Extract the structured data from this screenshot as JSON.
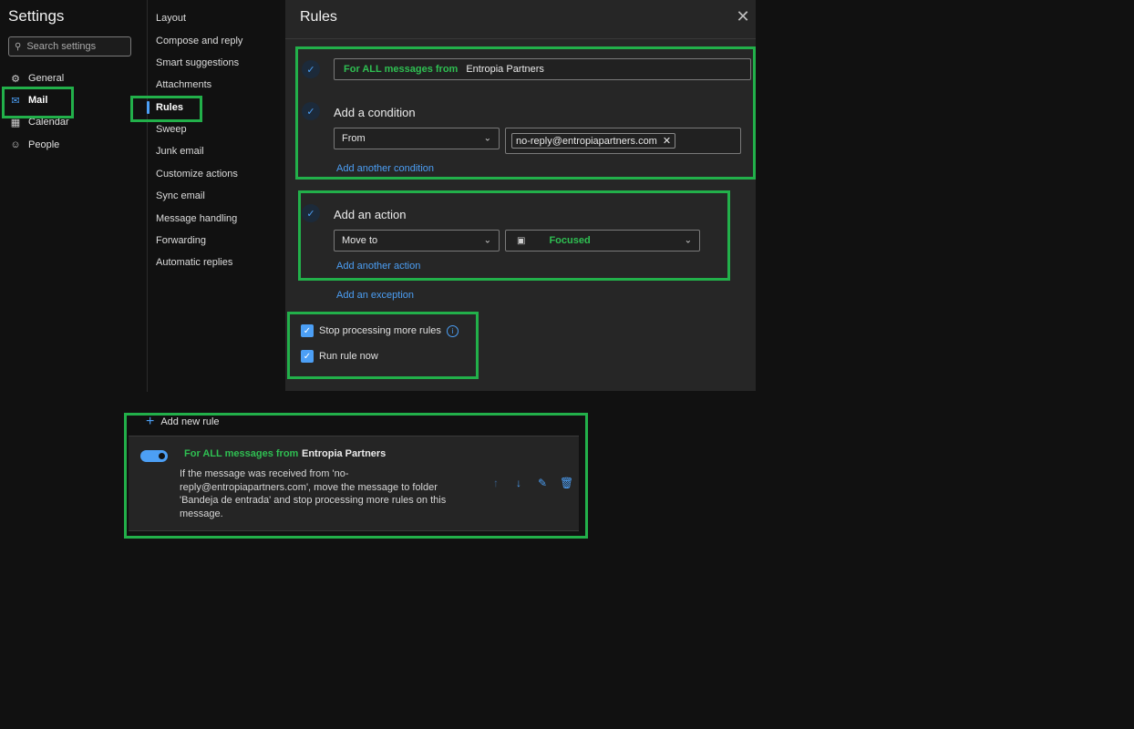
{
  "settings": {
    "title": "Settings",
    "search_placeholder": "Search settings",
    "nav": [
      {
        "label": "General",
        "icon": "gear-icon"
      },
      {
        "label": "Mail",
        "icon": "mail-icon"
      },
      {
        "label": "Calendar",
        "icon": "calendar-icon"
      },
      {
        "label": "People",
        "icon": "people-icon"
      }
    ]
  },
  "mail_nav": [
    "Layout",
    "Compose and reply",
    "Smart suggestions",
    "Attachments",
    "Rules",
    "Sweep",
    "Junk email",
    "Customize actions",
    "Sync email",
    "Message handling",
    "Forwarding",
    "Automatic replies"
  ],
  "rules_panel": {
    "title": "Rules",
    "rule_name_prefix": "For ALL messages from",
    "rule_name_value": "Entropia Partners",
    "condition_heading": "Add a condition",
    "condition_field": "From",
    "condition_value": "no-reply@entropiapartners.com",
    "add_condition_link": "Add another condition",
    "action_heading": "Add an action",
    "action_field": "Move to",
    "action_folder": "Focused",
    "add_action_link": "Add another action",
    "add_exception_link": "Add an exception",
    "stop_processing_label": "Stop processing more rules",
    "stop_processing_checked": true,
    "run_now_label": "Run rule now",
    "run_now_checked": true
  },
  "rule_list": {
    "add_new_rule": "Add new rule",
    "rule": {
      "prefix": "For ALL messages from",
      "name": "Entropia Partners",
      "enabled": true,
      "description": "If the message was received from 'no-reply@entropiapartners.com', move the message to folder 'Bandeja de entrada' and stop processing more rules on this message."
    }
  },
  "colors": {
    "accent": "#4c9ff5",
    "highlight": "#22b04a",
    "rule_green": "#2fbf52",
    "background": "#111111",
    "panel": "#262626"
  }
}
